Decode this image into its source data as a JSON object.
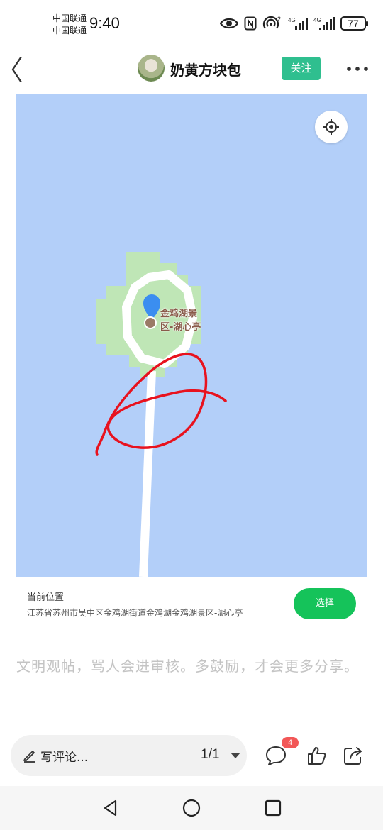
{
  "status_bar": {
    "carrier_1": "中国联通",
    "carrier_2": "中国联通",
    "time": "9:40",
    "battery": "77",
    "signal_1_label": "4G",
    "signal_2_label": "4G",
    "hotspot_sup": "2"
  },
  "header": {
    "username": "奶黄方块包",
    "follow_label": "关注"
  },
  "map": {
    "poi_line_1": "金鸡湖景",
    "poi_line_2": "区-湖心亭",
    "colors": {
      "water": "#b3cff9",
      "land": "#bfe6b6",
      "road": "#ffffff",
      "annotation": "#e8121e",
      "pin": "#3b8ef0"
    }
  },
  "location": {
    "title": "当前位置",
    "address": "江苏省苏州市吴中区金鸡湖街道金鸡湖金鸡湖景区-湖心亭",
    "select_label": "选择",
    "watermark": "奶黄方块包"
  },
  "comment_hint": "文明观帖，骂人会进审核。多鼓励，才会更多分享。",
  "bottom_bar": {
    "comment_placeholder": "写评论...",
    "pager": "1/1",
    "comment_count": "4"
  },
  "icons": {
    "back": "chevron-left-icon",
    "more": "more-dots-icon",
    "locate": "locate-icon",
    "pen": "pen-icon",
    "comment": "comment-bubble-icon",
    "like": "thumb-up-icon",
    "share": "share-icon"
  }
}
